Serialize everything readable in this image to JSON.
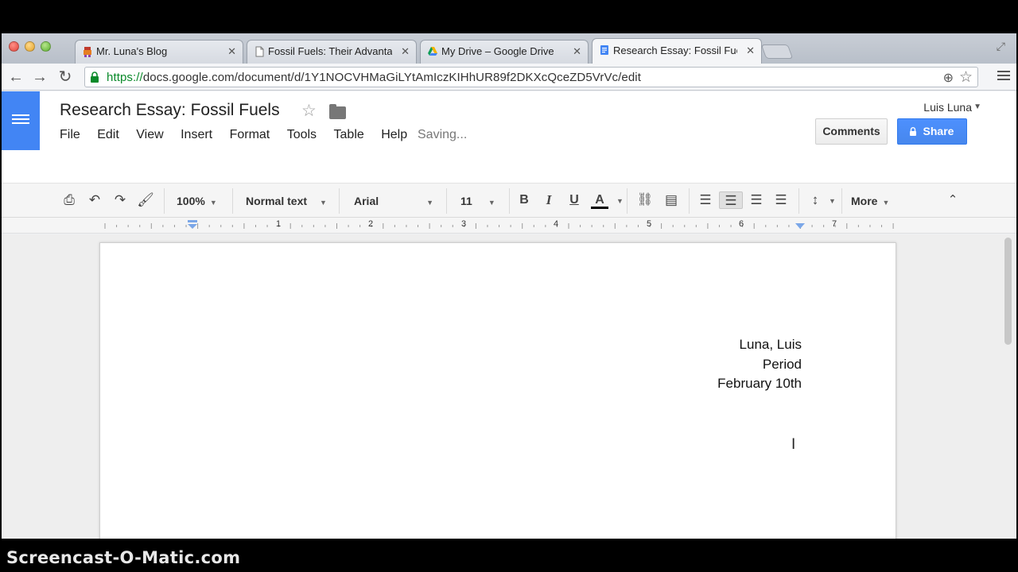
{
  "browser": {
    "tabs": [
      {
        "title": "Mr. Luna's Blog",
        "favicon": "blogger-icon",
        "active": false
      },
      {
        "title": "Fossil Fuels: Their Advanta",
        "favicon": "page-icon",
        "active": false
      },
      {
        "title": "My Drive – Google Drive",
        "favicon": "drive-icon",
        "active": false
      },
      {
        "title": "Research Essay: Fossil Fue",
        "favicon": "docs-icon",
        "active": true
      }
    ],
    "url_scheme": "https://",
    "url_rest": "docs.google.com/document/d/1Y1NOCVHMaGiLYtAmIczKIHhUR89f2DKXcQceZD5VrVc/edit"
  },
  "docs": {
    "title": "Research Essay: Fossil Fuels",
    "menus": [
      "File",
      "Edit",
      "View",
      "Insert",
      "Format",
      "Tools",
      "Table",
      "Help"
    ],
    "status": "Saving...",
    "user": "Luis Luna",
    "comments_label": "Comments",
    "share_label": "Share",
    "accent": "#4285f4"
  },
  "toolbar": {
    "zoom": "100%",
    "style": "Normal text",
    "font": "Arial",
    "size": "11",
    "bold": "B",
    "italic": "I",
    "underline": "U",
    "text_color": "A",
    "more": "More"
  },
  "ruler": {
    "numbers": [
      "1",
      "2",
      "3",
      "4",
      "5",
      "6",
      "7"
    ]
  },
  "document": {
    "lines": [
      "Luna, Luis",
      "Period",
      "February 10th"
    ]
  },
  "watermark": "Screencast-O-Matic.com"
}
